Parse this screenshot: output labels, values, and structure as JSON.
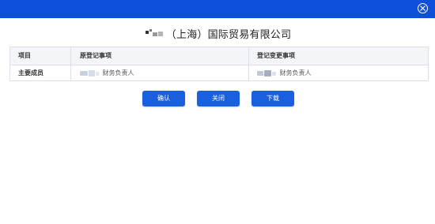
{
  "dialog": {
    "title": "（上海）国际贸易有限公司",
    "close_icon": "close-circle-icon"
  },
  "table": {
    "headers": [
      "项目",
      "原登记事项",
      "登记变更事项"
    ],
    "rows": [
      {
        "item": "主要成员",
        "original": "财务负责人",
        "changed": "财务负责人"
      }
    ]
  },
  "buttons": {
    "confirm": "确认",
    "close": "关闭",
    "download": "下载"
  },
  "colors": {
    "topbar": "#0e4fdc",
    "button": "#1a5fe0",
    "header_bg": "#f3f5f8",
    "border": "#dcdfe6"
  }
}
